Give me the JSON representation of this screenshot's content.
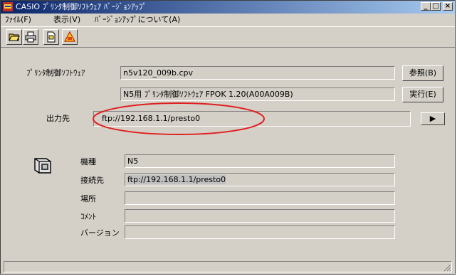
{
  "window": {
    "title": "CASIO ﾌﾟﾘﾝﾀ制御ｿﾌﾄｳｪｱ ﾊﾞｰｼﾞｮﾝｱｯﾌﾟ",
    "minimize_glyph": "_",
    "maximize_glyph": "□",
    "close_glyph": "×"
  },
  "menu": {
    "items": [
      {
        "label": "ﾌｧｲﾙ(F)"
      },
      {
        "label": "表示(V)"
      },
      {
        "label": "ﾊﾞｰｼﾞｮﾝｱｯﾌﾟについて(A)"
      }
    ]
  },
  "toolbar": {
    "buttons": [
      {
        "icon": "open-folder-icon"
      },
      {
        "icon": "printer-icon"
      },
      {
        "icon": "document-icon"
      },
      {
        "icon": "warning-icon"
      }
    ]
  },
  "form": {
    "software_label": "ﾌﾟﾘﾝﾀ制御ｿﾌﾄｳｪｱ",
    "software_file": "n5v120_009b.cpv",
    "software_desc": "N5用 ﾌﾟﾘﾝﾀ制御ｿﾌﾄｳｪｱ FPOK 1.20(A00A009B)",
    "browse_button": "参照(B)",
    "run_button": "実行(E)",
    "output_label": "出力先",
    "output_value": "ftp://192.168.1.1/presto0",
    "output_button_glyph": "▶"
  },
  "printer_info": {
    "model_label": "機種",
    "model_value": "N5",
    "connection_label": "接続先",
    "connection_value": "ftp://192.168.1.1/presto0",
    "location_label": "場所",
    "location_value": "",
    "comment_label": "ｺﾒﾝﾄ",
    "comment_value": "",
    "version_label": "バージョン",
    "version_value": ""
  },
  "status": {
    "text": ""
  },
  "colors": {
    "title_gradient_start": "#0a246a",
    "title_gradient_end": "#a6caf0",
    "window_face": "#d4d0c8",
    "annotation_ellipse": "#e02020"
  }
}
